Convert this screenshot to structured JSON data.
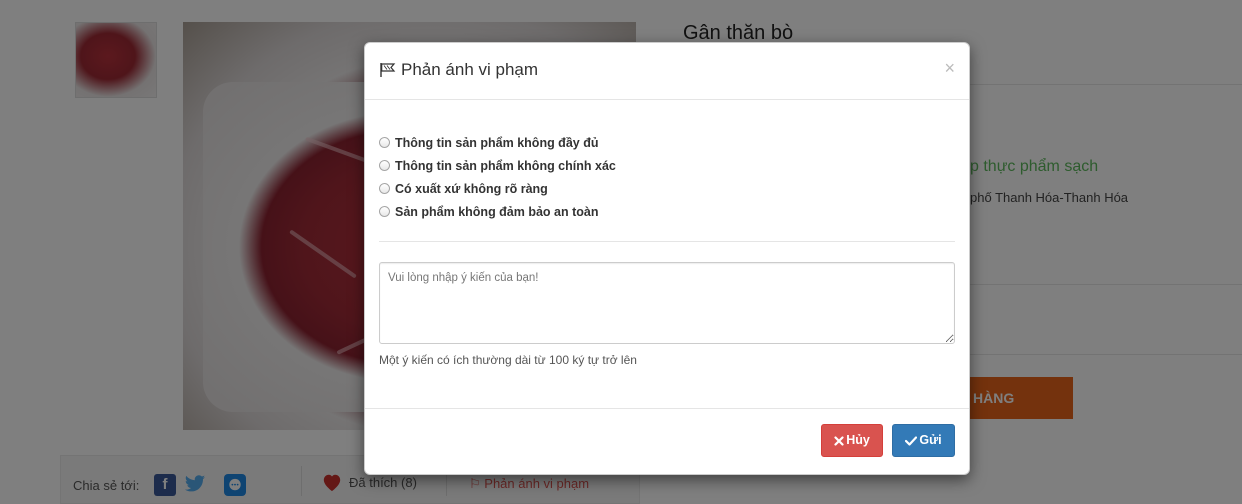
{
  "product": {
    "title": "Gân thăn bò",
    "shop_name_partial": "p thực phẩm sạch",
    "address_partial": "phố Thanh Hóa-Thanh Hóa",
    "buy_button_partial": "HÀNG"
  },
  "share": {
    "label": "Chia sẻ tới:",
    "likes": "Đã thích (8)",
    "report_link": "Phản ánh vi phạm"
  },
  "modal": {
    "title": "Phản ánh vi phạm",
    "close_glyph": "×",
    "options": [
      "Thông tin sản phẩm không đầy đủ",
      "Thông tin sản phẩm không chính xác",
      "Có xuất xứ không rõ ràng",
      "Sản phẩm không đảm bảo an toàn"
    ],
    "comment_placeholder": "Vui lòng nhập ý kiến của bạn!",
    "hint": "Một ý kiến có ích thường dài từ 100 ký tự trở lên",
    "cancel_label": "Hủy",
    "send_label": "Gửi"
  },
  "colors": {
    "cancel": "#d9534f",
    "send": "#337ab7",
    "buy": "#e8651a",
    "shop_green": "#5cb85c"
  }
}
